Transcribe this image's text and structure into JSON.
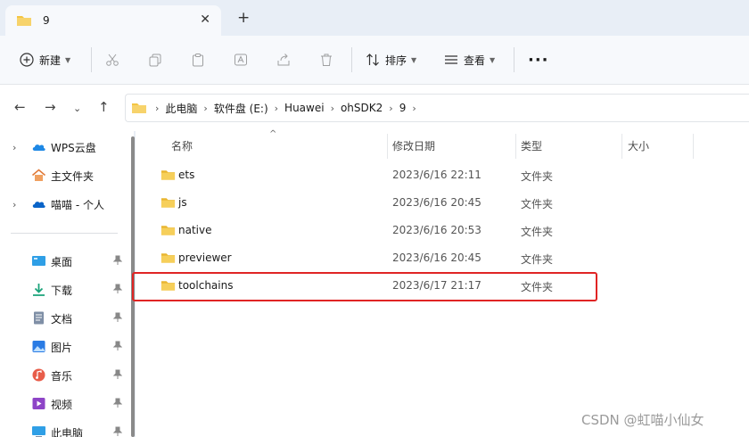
{
  "tab": {
    "title": "9"
  },
  "toolbar": {
    "new_label": "新建",
    "sort_label": "排序",
    "view_label": "查看"
  },
  "address": {
    "crumbs": [
      "此电脑",
      "软件盘 (E:)",
      "Huawei",
      "ohSDK2",
      "9"
    ]
  },
  "sidebar": {
    "items": [
      {
        "label": "WPS云盘"
      },
      {
        "label": "主文件夹"
      },
      {
        "label": "喵喵 - 个人"
      },
      {
        "label": "桌面"
      },
      {
        "label": "下载"
      },
      {
        "label": "文档"
      },
      {
        "label": "图片"
      },
      {
        "label": "音乐"
      },
      {
        "label": "视频"
      },
      {
        "label": "此电脑"
      }
    ]
  },
  "columns": {
    "name": "名称",
    "date": "修改日期",
    "type": "类型",
    "size": "大小"
  },
  "files": [
    {
      "name": "ets",
      "date": "2023/6/16 22:11",
      "type": "文件夹"
    },
    {
      "name": "js",
      "date": "2023/6/16 20:45",
      "type": "文件夹"
    },
    {
      "name": "native",
      "date": "2023/6/16 20:53",
      "type": "文件夹"
    },
    {
      "name": "previewer",
      "date": "2023/6/16 20:45",
      "type": "文件夹"
    },
    {
      "name": "toolchains",
      "date": "2023/6/17 21:17",
      "type": "文件夹"
    }
  ],
  "watermark": "CSDN @虹喵小仙女",
  "colors": {
    "folder": "#f4c542",
    "highlight": "#e02424",
    "accent": "#1a73e8"
  }
}
